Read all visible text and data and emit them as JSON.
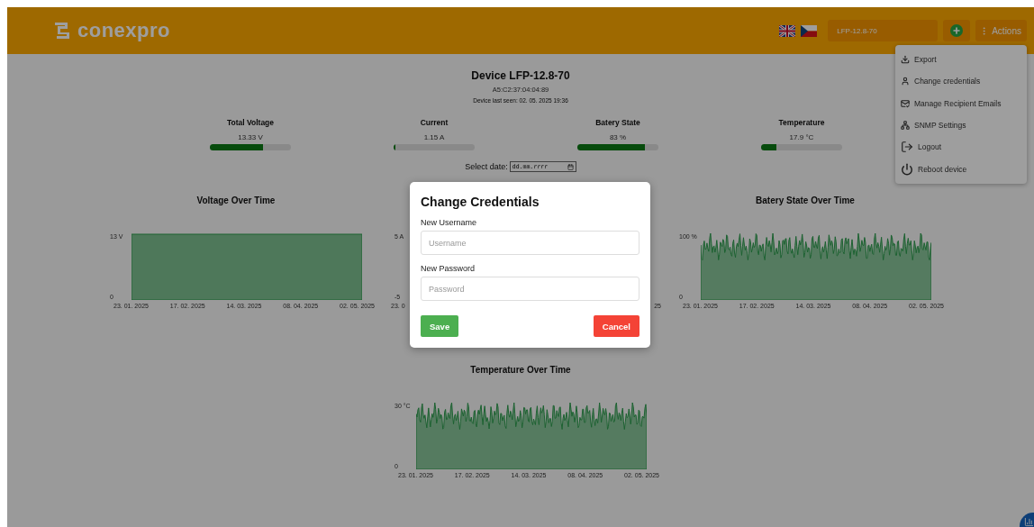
{
  "header": {
    "logo_text": "conexpro",
    "device_select": {
      "value": "LFP-12.8-70"
    },
    "actions_button": {
      "label": "Actions"
    }
  },
  "menu": {
    "items": [
      {
        "kind": "download",
        "label": "Export"
      },
      {
        "kind": "user",
        "label": "Change credentials"
      },
      {
        "kind": "mail",
        "label": "Manage Recipient Emails"
      },
      {
        "kind": "network",
        "label": "SNMP Settings"
      },
      {
        "kind": "logout",
        "label": "Logout"
      },
      {
        "kind": "power",
        "label": "Reboot device"
      }
    ]
  },
  "device": {
    "title": "Device LFP-12.8-70",
    "mac": "A5:C2:37:04:04:89",
    "last_seen": "Device last seen: 02. 05. 2025 19:36"
  },
  "metrics": [
    {
      "label": "Total Voltage",
      "value": "13.33 V",
      "level": 0.65
    },
    {
      "label": "Current",
      "value": "1.15 A",
      "level": 0.02
    },
    {
      "label": "Batery State",
      "value": "83 %",
      "level": 0.83
    },
    {
      "label": "Temperature",
      "value": "17.9 °C",
      "level": 0.19
    }
  ],
  "date_filter": {
    "label": "Select date:",
    "placeholder": "dd.mm.rrrr"
  },
  "charts": [
    {
      "title": "Voltage Over Time",
      "kind": "flat",
      "y_ticks": [
        "13 V",
        "0"
      ],
      "x_ticks": [
        "23. 01. 2025",
        "17. 02. 2025",
        "14. 03. 2025",
        "08. 04. 2025",
        "02. 05. 2025"
      ]
    },
    {
      "kind": "hidden",
      "y_ticks": [
        "5 A",
        "-5"
      ],
      "x_ticks": [
        "23. 0",
        "25"
      ]
    },
    {
      "title": "Batery State Over Time",
      "kind": "noisy",
      "y_ticks": [
        "100 %",
        "0"
      ],
      "x_ticks": [
        "23. 01. 2025",
        "17. 02. 2025",
        "14. 03. 2025",
        "08. 04. 2025",
        "02. 05. 2025"
      ]
    },
    {
      "title": "Temperature Over Time",
      "kind": "noisy",
      "y_ticks": [
        "30 °C",
        "0"
      ],
      "x_ticks": [
        "23. 01. 2025",
        "17. 02. 2025",
        "14. 03. 2025",
        "08. 04. 2025",
        "02. 05. 2025"
      ]
    }
  ],
  "dialog": {
    "title": "Change Credentials",
    "fields": [
      {
        "label": "New Username",
        "placeholder": "Username"
      },
      {
        "label": "New Password",
        "placeholder": "Password"
      }
    ],
    "buttons": [
      {
        "kind": "save",
        "label": "Save"
      },
      {
        "kind": "cancel",
        "label": "Cancel"
      }
    ]
  }
}
